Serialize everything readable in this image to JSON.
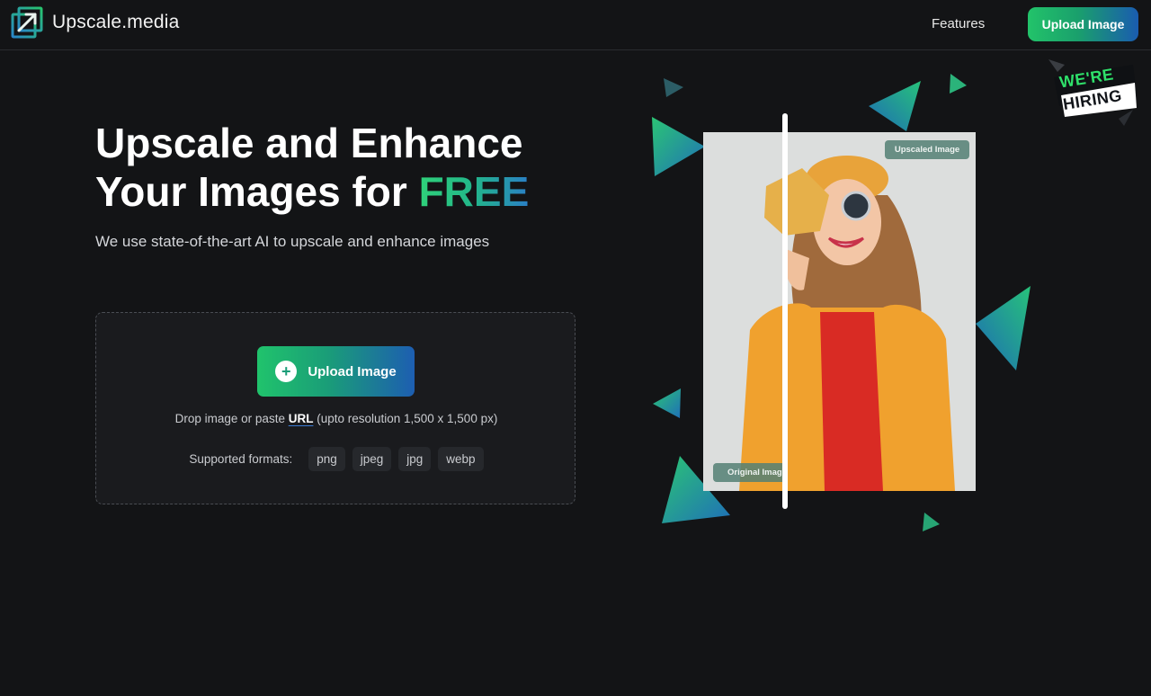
{
  "brand": {
    "name": "Upscale.media",
    "logo_icon": "upscale-arrow-icon",
    "accent_green": "#22c36a",
    "accent_blue": "#1d5eb1",
    "background": "#131416"
  },
  "header": {
    "nav_features": "Features",
    "upload_button": "Upload Image"
  },
  "hero": {
    "title_line1": "Upscale and Enhance",
    "title_line2_prefix": "Your Images for ",
    "title_line2_highlight": "FREE",
    "subtitle": "We use state-of-the-art AI to upscale and enhance images"
  },
  "upload": {
    "button_label": "Upload Image",
    "button_icon": "plus-circle-icon",
    "drop_text_before": "Drop image or paste ",
    "drop_link": "URL",
    "drop_text_after": " (upto resolution 1,500 x 1,500 px)",
    "formats_label": "Supported formats:",
    "formats": [
      "png",
      "jpeg",
      "jpg",
      "webp"
    ]
  },
  "illustration": {
    "badge_upscaled": "Upscaled Image",
    "badge_original": "Original Image",
    "hiring_line1": "WE'RE",
    "hiring_line2": "HIRING"
  }
}
